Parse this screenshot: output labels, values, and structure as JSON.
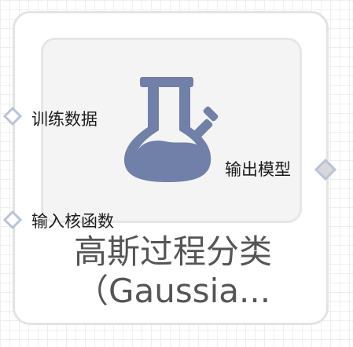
{
  "node": {
    "title_line1": "高斯过程分类",
    "title_line2": "（Gaussia...",
    "icon": "flask-icon",
    "icon_color": "#7180a8",
    "inputs": [
      {
        "label": "训练数据"
      },
      {
        "label": "输入核函数"
      }
    ],
    "outputs": [
      {
        "label": "输出模型"
      }
    ]
  },
  "colors": {
    "card_border": "#e3e3e3",
    "panel_background": "#f4f4f4",
    "port_stroke": "#b9c3db",
    "output_port_fill": "#d8d8d8",
    "title_text": "#555555"
  }
}
